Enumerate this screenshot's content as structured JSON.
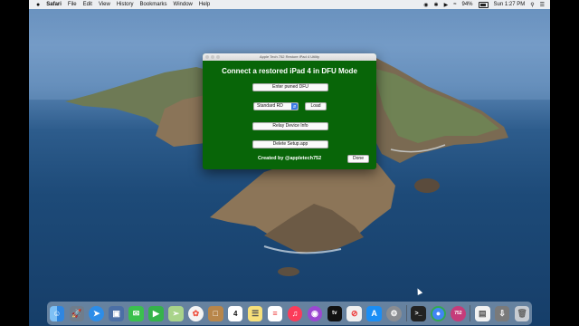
{
  "menubar": {
    "app_name": "Safari",
    "items": [
      "File",
      "Edit",
      "View",
      "History",
      "Bookmarks",
      "Window",
      "Help"
    ],
    "battery": "94%",
    "clock": "Sun 1:27 PM"
  },
  "dialog": {
    "title": "Apple Tech 752 Restore iPad 4 Utility",
    "heading": "Connect a restored iPad 4 in DFU Mode",
    "enter_pwned_label": "Enter pwned DFU",
    "ramdisk_select_value": "Standard RD",
    "load_label": "Load",
    "relay_info_label": "Relay Device Info",
    "delete_setup_label": "Delete Setup.app",
    "credit": "Created by @appletech752",
    "done_label": "Done"
  },
  "dock": {
    "icons": [
      "finder-icon",
      "launchpad-icon",
      "safari-icon",
      "photos-browser-icon",
      "messages-icon",
      "facetime-icon",
      "maps-icon",
      "photos-icon",
      "notes-books-icon",
      "calendar-icon",
      "notes-icon",
      "reminders-icon",
      "music-icon",
      "podcasts-icon",
      "appletv-icon",
      "news-icon",
      "appstore-icon",
      "system-preferences-icon",
      "terminal-icon",
      "chrome-icon",
      "app752-icon",
      "document-icon",
      "downloads-icon",
      "trash-icon"
    ],
    "calendar_day": "4",
    "app752_label": "752"
  }
}
